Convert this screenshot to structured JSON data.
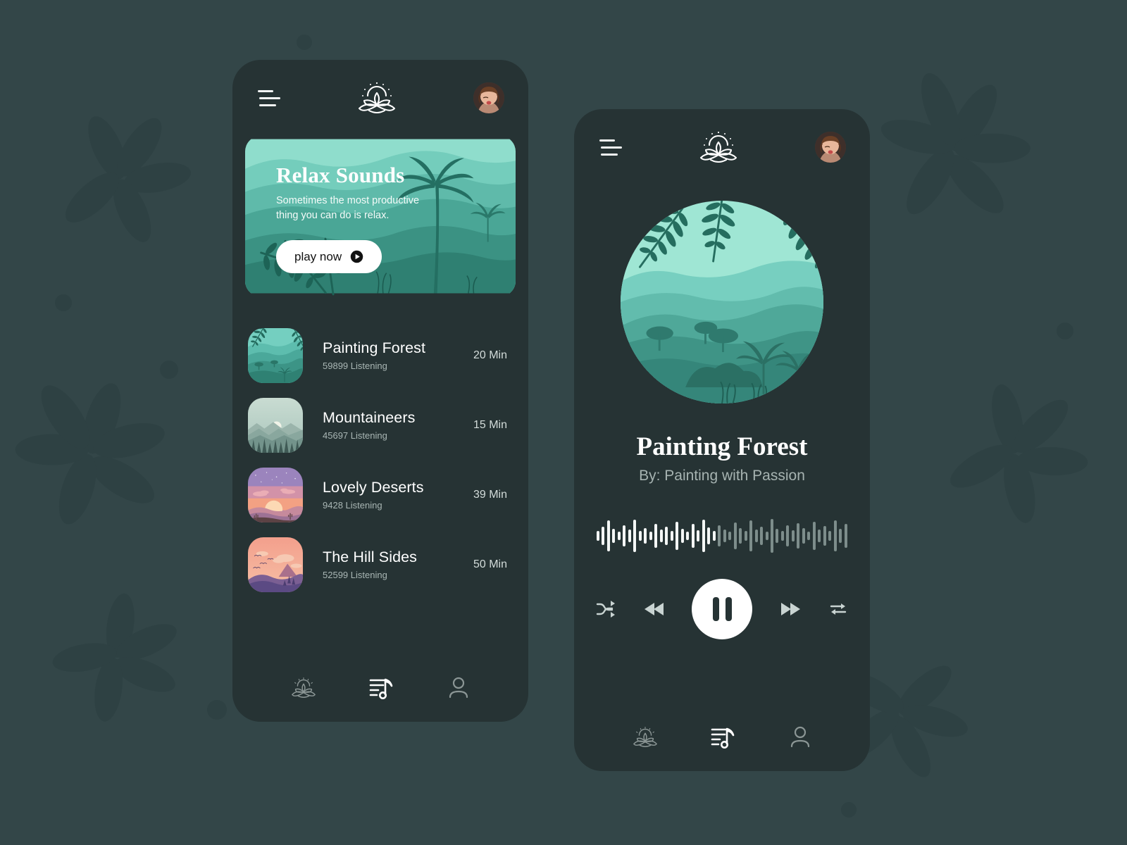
{
  "theme": {
    "page_bg": "#334648",
    "phone_bg": "#263334",
    "accent_white": "#ffffff",
    "muted_text": "#a9b6b4",
    "teal_light": "#8fe0cf",
    "teal_mid": "#4aa893",
    "teal_dark": "#1f6b5c"
  },
  "home": {
    "header": {
      "menu_icon": "hamburger-menu-icon",
      "logo_icon": "lotus-logo-icon",
      "avatar_icon": "user-avatar"
    },
    "hero": {
      "title": "Relax Sounds",
      "subtitle": "Sometimes the most productive thing you can do is relax.",
      "button_label": "play now",
      "button_icon": "play-circle-icon"
    },
    "tracks": [
      {
        "name": "Painting Forest",
        "listeners": "59899 Listening",
        "duration": "20 Min",
        "art": "forest"
      },
      {
        "name": "Mountaineers",
        "listeners": "45697 Listening",
        "duration": "15 Min",
        "art": "mountains"
      },
      {
        "name": "Lovely Deserts",
        "listeners": "9428  Listening",
        "duration": "39 Min",
        "art": "desert"
      },
      {
        "name": "The Hill Sides",
        "listeners": "52599 Listening",
        "duration": "50 Min",
        "art": "hills"
      }
    ],
    "nav": [
      {
        "id": "home",
        "icon": "lotus-icon",
        "active": false
      },
      {
        "id": "playlist",
        "icon": "playlist-icon",
        "active": true
      },
      {
        "id": "profile",
        "icon": "person-icon",
        "active": false
      }
    ]
  },
  "player": {
    "header": {
      "menu_icon": "hamburger-menu-icon",
      "logo_icon": "lotus-logo-icon",
      "avatar_icon": "user-avatar"
    },
    "album_art": "forest-circle",
    "track_title": "Painting Forest",
    "track_artist": "By: Painting with Passion",
    "waveform": {
      "bars": 48,
      "progress_percent": 47,
      "heights": [
        14,
        26,
        44,
        20,
        12,
        30,
        18,
        46,
        14,
        22,
        12,
        34,
        18,
        26,
        14,
        40,
        20,
        12,
        34,
        16,
        46,
        24,
        14,
        30,
        18,
        12,
        38,
        22,
        14,
        44,
        18,
        26,
        12,
        48,
        20,
        14,
        30,
        16,
        36,
        22,
        12,
        40,
        18,
        28,
        14,
        44,
        20,
        34
      ],
      "played_color": "#f4f7f6",
      "remaining_color": "#7d8d8b"
    },
    "controls": {
      "shuffle": "shuffle-icon",
      "previous": "rewind-icon",
      "play_pause": "pause-icon",
      "next": "fast-forward-icon",
      "repeat": "repeat-icon",
      "state": "playing"
    },
    "nav": [
      {
        "id": "home",
        "icon": "lotus-icon",
        "active": false
      },
      {
        "id": "playlist",
        "icon": "playlist-icon",
        "active": true
      },
      {
        "id": "profile",
        "icon": "person-icon",
        "active": false
      }
    ]
  }
}
